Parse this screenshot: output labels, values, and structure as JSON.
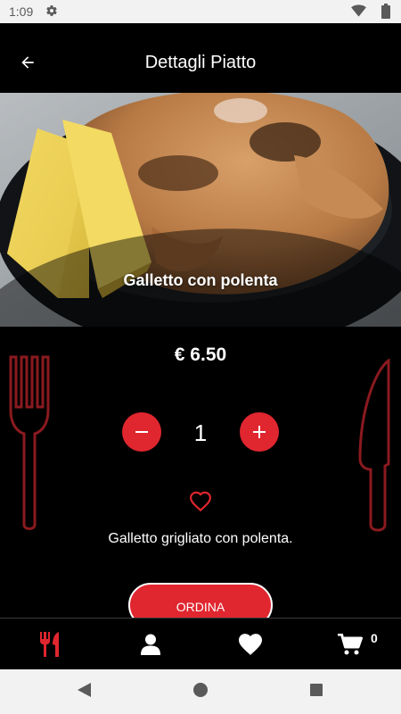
{
  "status_bar": {
    "time": "1:09",
    "icons": [
      "gear-icon",
      "wifi-icon",
      "battery-icon"
    ]
  },
  "app_bar": {
    "title": "Dettagli Piatto",
    "back_icon": "arrow-left-icon"
  },
  "dish": {
    "name": "Galletto con polenta",
    "price": "€ 6.50",
    "quantity": "1",
    "description": "Galletto grigliato con polenta.",
    "favorite_icon": "heart-outline-icon"
  },
  "actions": {
    "order_label": "ORDINA",
    "decrease_icon": "minus-icon",
    "increase_icon": "plus-icon"
  },
  "bottom_nav": {
    "items": [
      {
        "icon": "utensils-icon",
        "active": true
      },
      {
        "icon": "user-icon",
        "active": false
      },
      {
        "icon": "heart-icon",
        "active": false
      },
      {
        "icon": "cart-icon",
        "active": false
      }
    ],
    "cart_count": "0"
  },
  "colors": {
    "accent": "#e0262f",
    "background": "#000000",
    "text": "#ffffff",
    "decoration": "#8a1a1f"
  }
}
